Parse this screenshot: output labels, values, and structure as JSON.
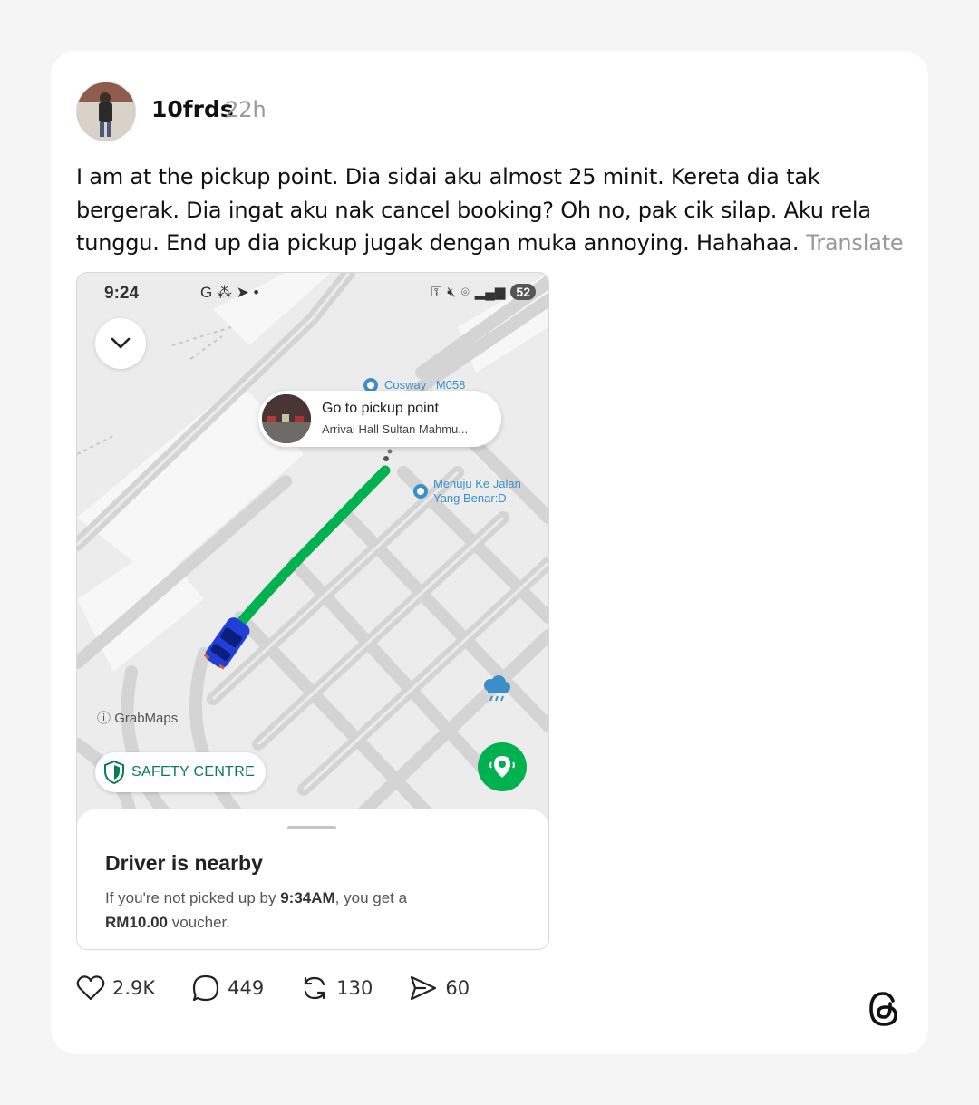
{
  "post": {
    "username": "10frds",
    "time": "22h",
    "text": "I am at the pickup point. Dia sidai aku almost 25 minit. Kereta dia tak bergerak. Dia ingat aku nak cancel booking? Oh no, pak cik silap. Aku rela tunggu. End up dia pickup jugak dengan muka annoying. Hahahaa.",
    "translate_label": "Translate"
  },
  "screenshot": {
    "status": {
      "time": "9:24",
      "left_icons": "G ⁂ ➤ •",
      "battery": "52"
    },
    "map": {
      "poi_1": "Cosway | M058",
      "poi_2_line1": "Menuju Ke Jalan",
      "poi_2_line2": "Yang Benar:D",
      "attribution": "GrabMaps",
      "route_color": "#00b14f"
    },
    "bubble": {
      "title": "Go to pickup point",
      "subtitle": "Arrival Hall Sultan Mahmu..."
    },
    "safety_label": "SAFETY CENTRE",
    "sheet": {
      "title": "Driver is nearby",
      "line1_pre": "If you're not picked up by ",
      "line1_time": "9:34AM",
      "line1_post": ", you get a",
      "line2_amount": "RM10.00",
      "line2_post": " voucher."
    }
  },
  "actions": {
    "likes": "2.9K",
    "replies": "449",
    "reposts": "130",
    "shares": "60"
  }
}
